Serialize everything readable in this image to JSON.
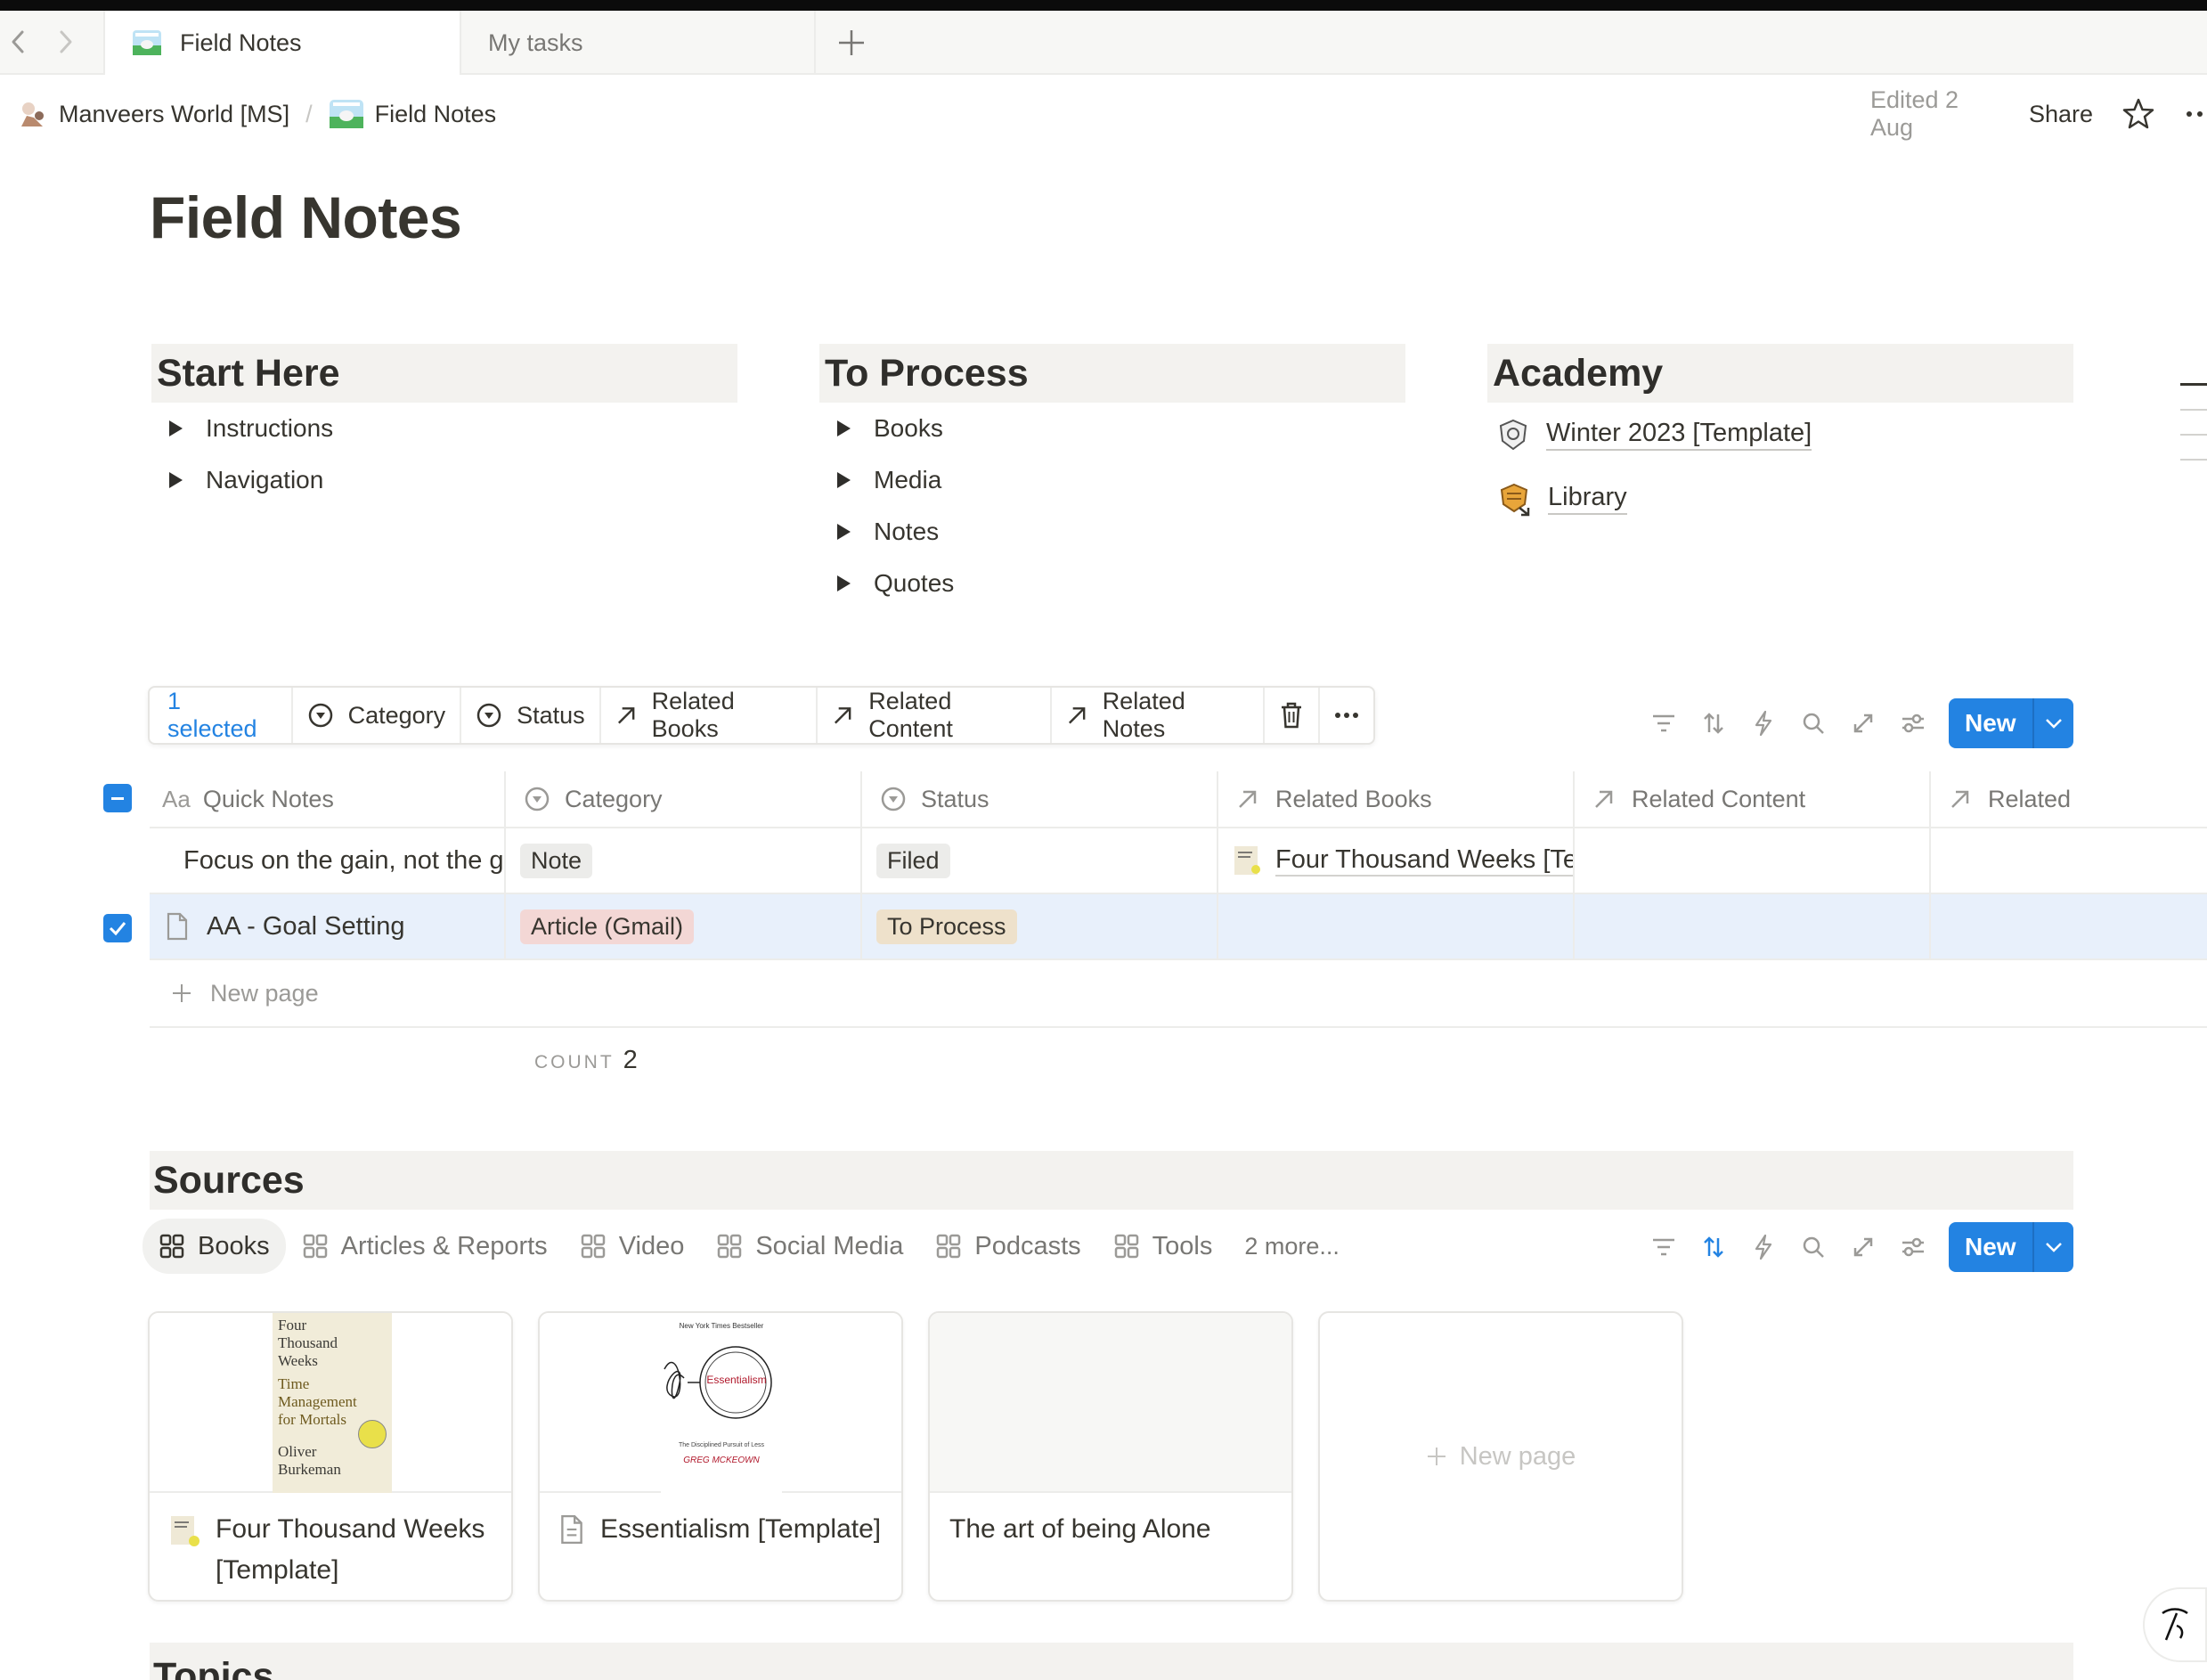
{
  "browser": {
    "tabs": [
      {
        "label": "Field Notes",
        "active": true
      },
      {
        "label": "My tasks",
        "active": false
      }
    ],
    "new_tab_symbol": "+"
  },
  "header": {
    "breadcrumb": [
      "Manveers World [MS]",
      "Field Notes"
    ],
    "edited": "Edited 2 Aug",
    "share": "Share"
  },
  "page": {
    "title": "Field Notes"
  },
  "columns": {
    "start_here": {
      "title": "Start Here",
      "items": [
        "Instructions",
        "Navigation"
      ]
    },
    "to_process": {
      "title": "To Process",
      "items": [
        "Books",
        "Media",
        "Notes",
        "Quotes"
      ]
    },
    "academy": {
      "title": "Academy",
      "links": [
        "Winter 2023 [Template]",
        "Library"
      ]
    }
  },
  "selection_toolbar": {
    "selected": "1 selected",
    "items": [
      "Category",
      "Status",
      "Related Books",
      "Related Content",
      "Related Notes"
    ]
  },
  "db_toolbar": {
    "new_label": "New"
  },
  "table": {
    "headers": [
      "Quick Notes",
      "Category",
      "Status",
      "Related Books",
      "Related Content",
      "Related"
    ],
    "rows": [
      {
        "name": "Focus on the gain, not the gap.",
        "category": "Note",
        "status": "Filed",
        "related_books": "Four Thousand Weeks [Te",
        "selected": false
      },
      {
        "name": "AA - Goal Setting",
        "category": "Article (Gmail)",
        "status": "To Process",
        "related_books": "",
        "selected": true
      }
    ],
    "new_page": "New page",
    "count_label": "COUNT",
    "count_value": "2"
  },
  "sources": {
    "title": "Sources",
    "tabs": [
      "Books",
      "Articles & Reports",
      "Video",
      "Social Media",
      "Podcasts",
      "Tools"
    ],
    "more": "2 more...",
    "new_label": "New",
    "cards": [
      {
        "title": "Four Thousand Weeks [Template]",
        "cover_lines": [
          "Four",
          "Thousand",
          "Weeks",
          "Time",
          "Management",
          "for Mortals",
          "Oliver",
          "Burkeman"
        ]
      },
      {
        "title": "Essentialism [Template]",
        "cover_top": "New York Times Bestseller",
        "cover_word": "Essentialism",
        "cover_sub": "The Disciplined Pursuit of Less",
        "cover_author": "GREG MCKEOWN"
      },
      {
        "title": "The art of being Alone"
      }
    ],
    "new_page": "New page"
  },
  "topics": {
    "title": "Topics"
  },
  "colors": {
    "accent": "#2383e2",
    "tag_note": "#ececea",
    "tag_article": "#f3d7d5",
    "tag_filed": "#ececea",
    "tag_to_process": "#eee1cb",
    "selected_row": "#e8f0fb"
  }
}
